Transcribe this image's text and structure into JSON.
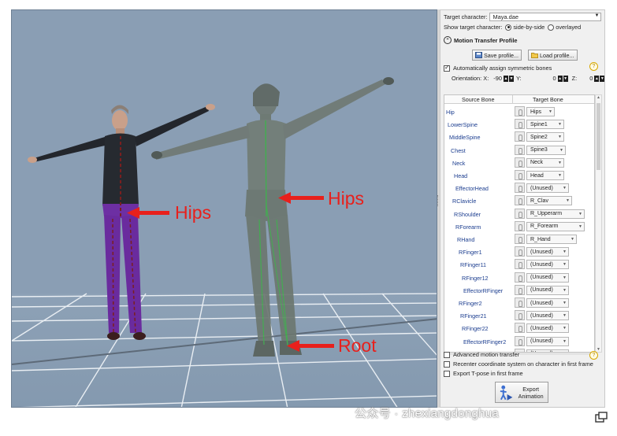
{
  "viewport": {
    "annotations": {
      "hips_left": "Hips",
      "hips_right": "Hips",
      "root": "Root"
    },
    "colors": {
      "annotation": "#e8201c",
      "background": "#8a9eb4"
    }
  },
  "panel": {
    "target_character_label": "Target character:",
    "target_character_value": "Maya.dae",
    "show_target_label": "Show target character:",
    "show_options": [
      "side-by-side",
      "overlayed"
    ],
    "show_selected": "side-by-side",
    "profile_title": "Motion Transfer Profile",
    "save_profile": "Save profile...",
    "load_profile": "Load profile...",
    "auto_symmetric_label": "Automatically assign symmetric bones",
    "auto_symmetric_checked": true,
    "orientation": {
      "label": "Orientation: X:",
      "x": "-90",
      "y_label": "Y:",
      "y": "0",
      "z_label": "Z:",
      "z": "0"
    },
    "help_glyph": "?",
    "columns": [
      "Source Bone",
      "Target Bone"
    ],
    "bones": [
      {
        "source": "Hip",
        "target": "Hips"
      },
      {
        "source": "LowerSpine",
        "target": "Spine1"
      },
      {
        "source": "MiddleSpine",
        "target": "Spine2"
      },
      {
        "source": "Chest",
        "target": "Spine3"
      },
      {
        "source": "Neck",
        "target": "Neck"
      },
      {
        "source": "Head",
        "target": "Head"
      },
      {
        "source": "EffectorHead",
        "target": "(Unused)"
      },
      {
        "source": "RClavicle",
        "target": "R_Clav"
      },
      {
        "source": "RShoulder",
        "target": "R_Upperarm"
      },
      {
        "source": "RForearm",
        "target": "R_Forearm"
      },
      {
        "source": "RHand",
        "target": "R_Hand"
      },
      {
        "source": "RFinger1",
        "target": "(Unused)"
      },
      {
        "source": "RFinger11",
        "target": "(Unused)"
      },
      {
        "source": "RFinger12",
        "target": "(Unused)"
      },
      {
        "source": "EffectorRFinger",
        "target": "(Unused)"
      },
      {
        "source": "RFinger2",
        "target": "(Unused)"
      },
      {
        "source": "RFinger21",
        "target": "(Unused)"
      },
      {
        "source": "RFinger22",
        "target": "(Unused)"
      },
      {
        "source": "EffectorRFinger2",
        "target": "(Unused)"
      },
      {
        "source": "RFinger3",
        "target": "(Unused)"
      }
    ],
    "advanced_label": "Advanced motion transfer",
    "recenter_label": "Recenter coordinate system on character in first frame",
    "export_tpose_label": "Export T-pose in first frame",
    "export_button": "Export Animation"
  },
  "watermark": "公众号 · zhexiangdonghua",
  "icons": [
    "radio-icon",
    "checkbox-icon",
    "save-icon",
    "folder-icon",
    "help-icon",
    "bone-picker-icon",
    "dropdown-arrow-icon",
    "export-animation-icon",
    "collapse-icon"
  ]
}
